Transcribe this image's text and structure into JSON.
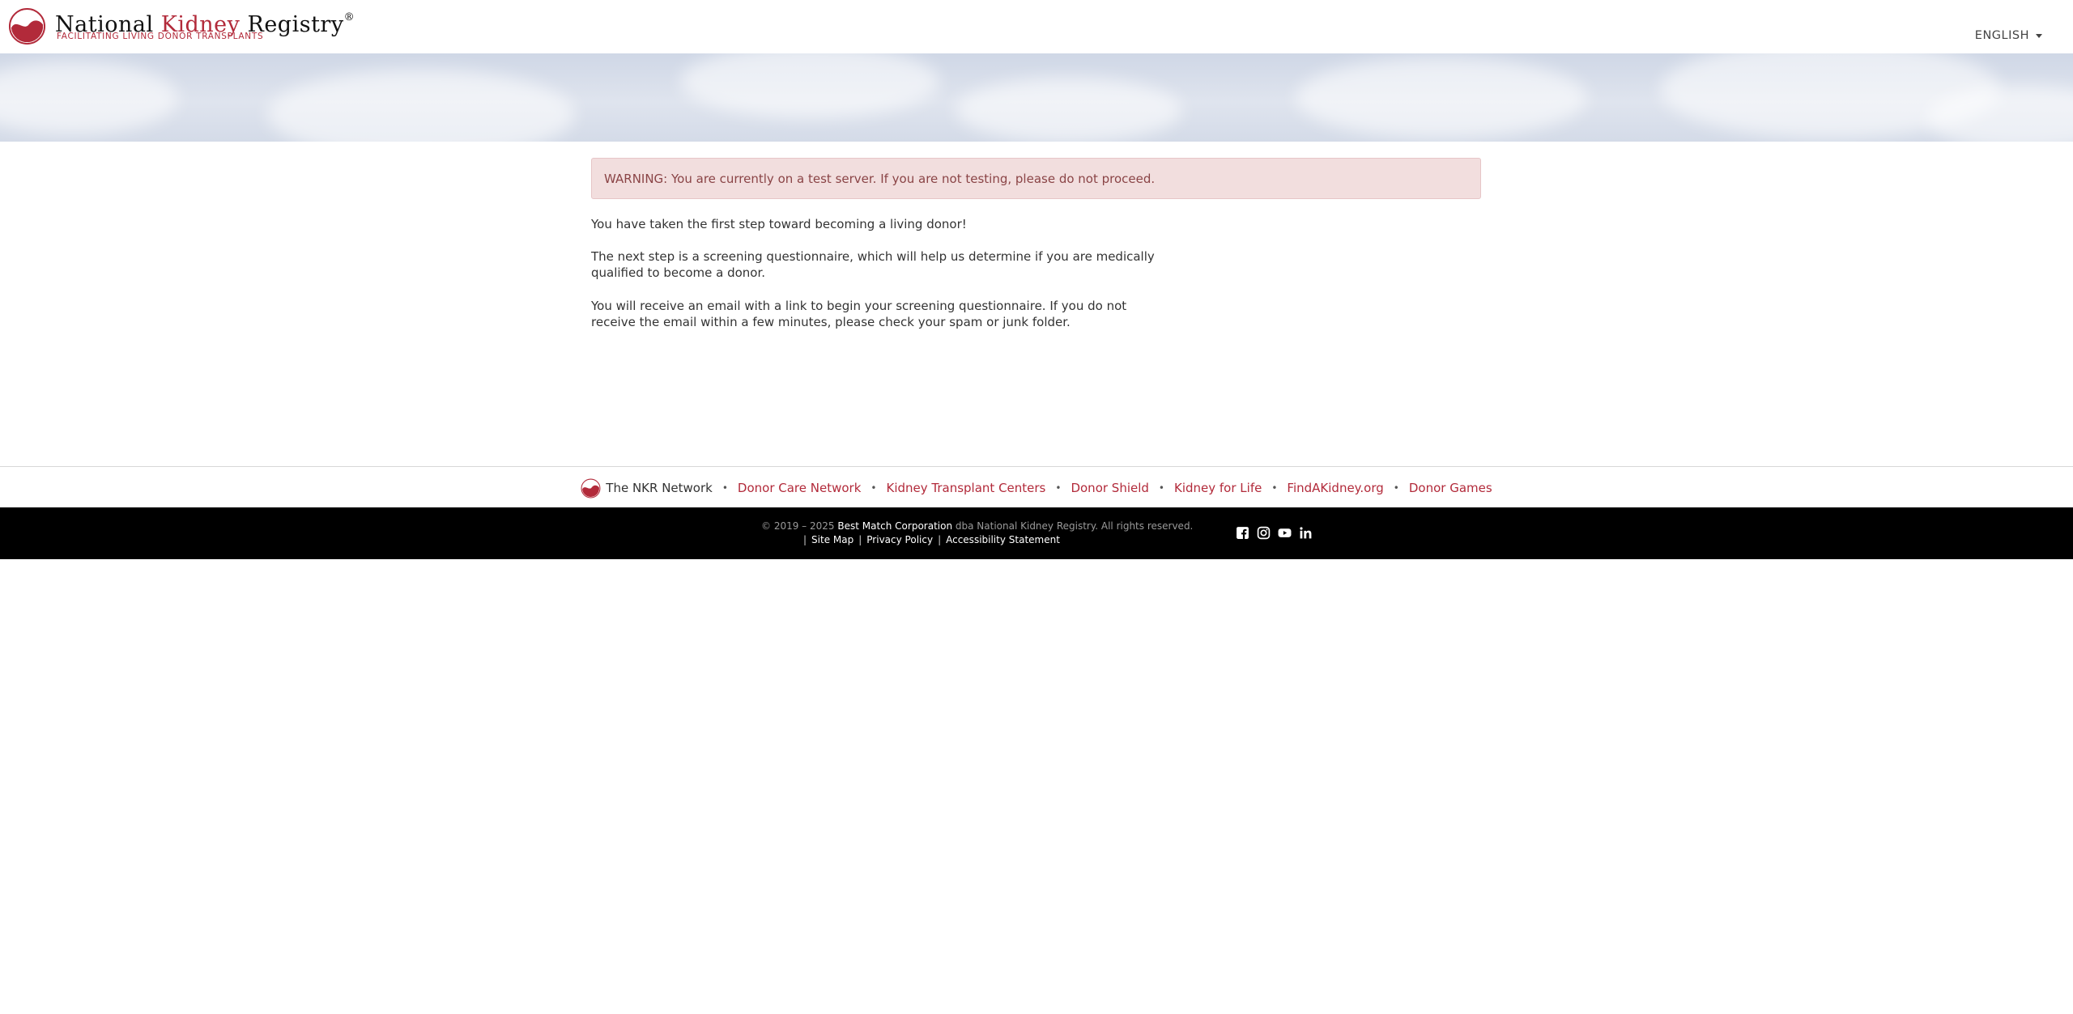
{
  "header": {
    "brand_word1": "National",
    "brand_word2": "Kidney",
    "brand_word3": "Registry",
    "registered_mark": "®",
    "tagline": "FACILITATING LIVING DONOR TRANSPLANTS",
    "language": "ENGLISH"
  },
  "main": {
    "warning": "WARNING: You are currently on a test server. If you are not testing, please do not proceed.",
    "paragraph_1": "You have taken the first step toward becoming a living donor!",
    "paragraph_2": "The next step is a screening questionnaire, which will help us determine if you are medically qualified to become a donor.",
    "paragraph_3": "You will receive an email with a link to begin your screening questionnaire. If you do not receive the email within a few minutes, please check your spam or junk folder."
  },
  "network": {
    "title": "The NKR Network",
    "links": [
      "Donor Care Network",
      "Kidney Transplant Centers",
      "Donor Shield",
      "Kidney for Life",
      "FindAKidney.org",
      "Donor Games"
    ]
  },
  "footer": {
    "copyright_prefix": "© 2019 – 2025",
    "company": "Best Match Corporation",
    "copyright_suffix": "dba National Kidney Registry. All rights reserved.",
    "separator": "|",
    "site_map": "Site Map",
    "privacy": "Privacy Policy",
    "accessibility": "Accessibility Statement",
    "social_icons": [
      "facebook-icon",
      "instagram-icon",
      "youtube-icon",
      "linkedin-icon"
    ]
  },
  "colors": {
    "brand_red": "#b22a3a",
    "warning_bg": "#f2dede",
    "warning_text": "#8a4446",
    "footer_bg": "#000000"
  }
}
